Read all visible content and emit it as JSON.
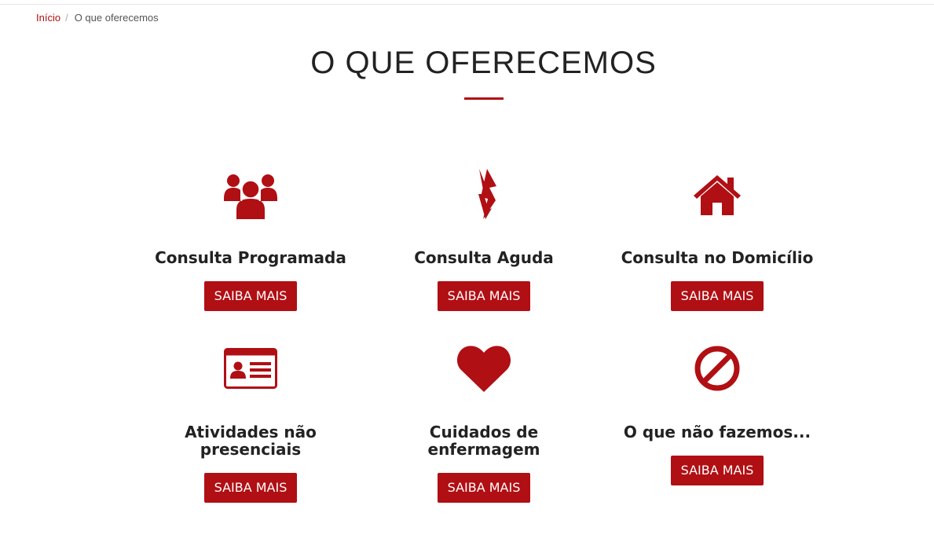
{
  "breadcrumb": {
    "home": "Início",
    "separator": "/",
    "current": "O que oferecemos"
  },
  "page": {
    "title": "O QUE OFERECEMOS"
  },
  "accent_color": "#b00f14",
  "services": [
    {
      "icon": "users-icon",
      "title": "Consulta Programada",
      "button": "SAIBA MAIS"
    },
    {
      "icon": "bolt-icon",
      "title": "Consulta Aguda",
      "button": "SAIBA MAIS"
    },
    {
      "icon": "home-icon",
      "title": "Consulta no Domicílio",
      "button": "SAIBA MAIS"
    },
    {
      "icon": "id-card-icon",
      "title": "Atividades não presenciais",
      "button": "SAIBA MAIS"
    },
    {
      "icon": "heart-icon",
      "title": "Cuidados de enfermagem",
      "button": "SAIBA MAIS"
    },
    {
      "icon": "ban-icon",
      "title": "O que não fazemos...",
      "button": "SAIBA MAIS"
    }
  ]
}
